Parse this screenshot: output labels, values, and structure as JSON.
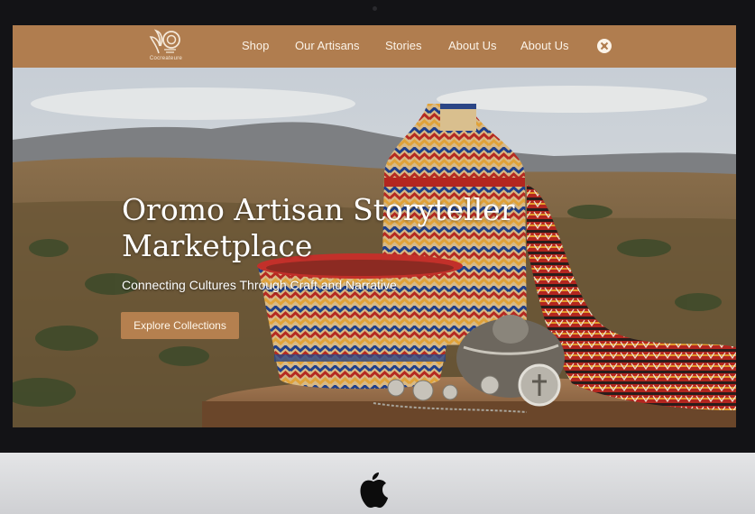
{
  "nav": {
    "logo_text": "Cocreateure",
    "links": [
      "Shop",
      "Our Artisans",
      "Stories",
      "About Us",
      "About Us"
    ],
    "icon": "share-icon"
  },
  "hero": {
    "title": "Oromo Artisan Storyteller Marketplace",
    "subtitle": "Connecting Cultures Through Craft and Narrative",
    "cta_label": "Explore Collections"
  },
  "colors": {
    "nav_bg": "#b07d4f",
    "button_bg": "#b5804f",
    "text": "#ffffff"
  },
  "device": {
    "logo": "apple-logo"
  }
}
